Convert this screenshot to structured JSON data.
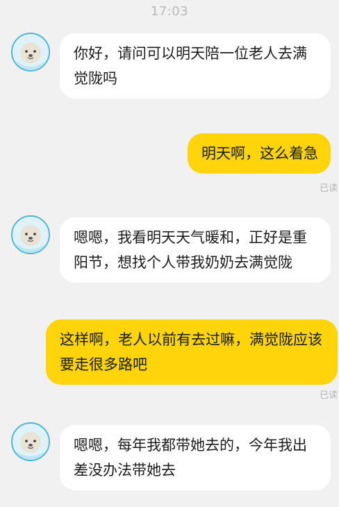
{
  "status_time": "17:03",
  "messages": [
    {
      "sender": "other",
      "text": "你好，请问可以明天陪一位老人去满觉陇吗"
    },
    {
      "sender": "me",
      "text": "明天啊，这么着急",
      "read_label": "已读"
    },
    {
      "sender": "other",
      "text": "嗯嗯，我看明天天气暖和，正好是重阳节，想找个人带我奶奶去满觉陇"
    },
    {
      "sender": "me",
      "text": "这样啊，老人以前有去过嘛，满觉陇应该要走很多路吧",
      "read_label": "已读"
    },
    {
      "sender": "other",
      "text": "嗯嗯，每年我都带她去的，今年我出差没办法带她去"
    }
  ],
  "colors": {
    "background": "#f1f1f1",
    "incoming_bubble": "#ffffff",
    "outgoing_bubble": "#ffd40a",
    "avatar_ring": "#4fb7d4"
  },
  "icons": {
    "contact_avatar": "seal-avatar-icon"
  }
}
